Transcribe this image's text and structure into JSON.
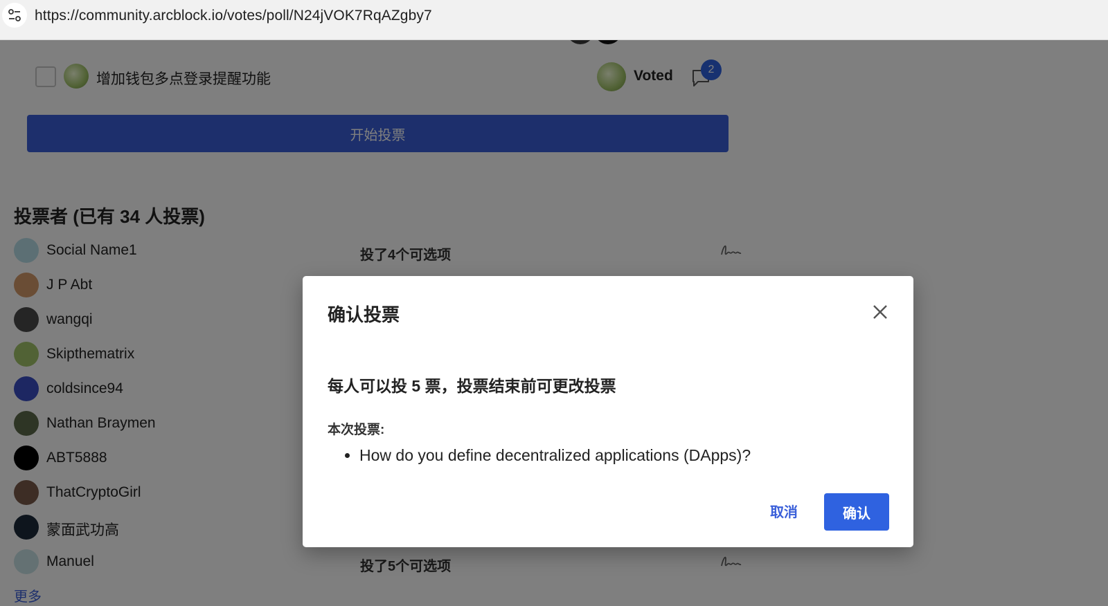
{
  "browser": {
    "url": "https://community.arcblock.io/votes/poll/N24jVOK7RqAZgby7"
  },
  "option": {
    "label": "增加钱包多点登录提醒功能",
    "status": "Voted",
    "comment_count": "2"
  },
  "start_vote_label": "开始投票",
  "voters": {
    "title": "投票者 (已有 34 人投票)",
    "list": [
      {
        "name": "Social Name1",
        "count_label": "投了4个可选项",
        "avatar_color": "#b9dfe9"
      },
      {
        "name": "J P Abt",
        "avatar_color": "#d49a6a"
      },
      {
        "name": "wangqi",
        "avatar_color": "#4a4a4a"
      },
      {
        "name": "Skipthematrix",
        "avatar_color": "#a2c46a"
      },
      {
        "name": "coldsince94",
        "avatar_color": "#3b4fc4"
      },
      {
        "name": "Nathan Braymen",
        "avatar_color": "#5d6b4a"
      },
      {
        "name": "ABT5888",
        "avatar_color": "#000000"
      },
      {
        "name": "ThatCryptoGirl",
        "avatar_color": "#7a5a4a"
      },
      {
        "name": "蒙面武功高",
        "avatar_color": "#1c2a3a"
      },
      {
        "name": "Manuel",
        "count_label": "投了5个可选项",
        "avatar_color": "#c9e3e6"
      }
    ],
    "more_label": "更多"
  },
  "dialog": {
    "title": "确认投票",
    "rule": "每人可以投 5 票，投票结束前可更改投票",
    "sub_label": "本次投票:",
    "items": [
      "How do you define decentralized applications (DApps)?"
    ],
    "cancel_label": "取消",
    "confirm_label": "确认"
  },
  "colors": {
    "primary": "#2f62e0",
    "overlay": "rgba(0,0,0,0.5)"
  }
}
